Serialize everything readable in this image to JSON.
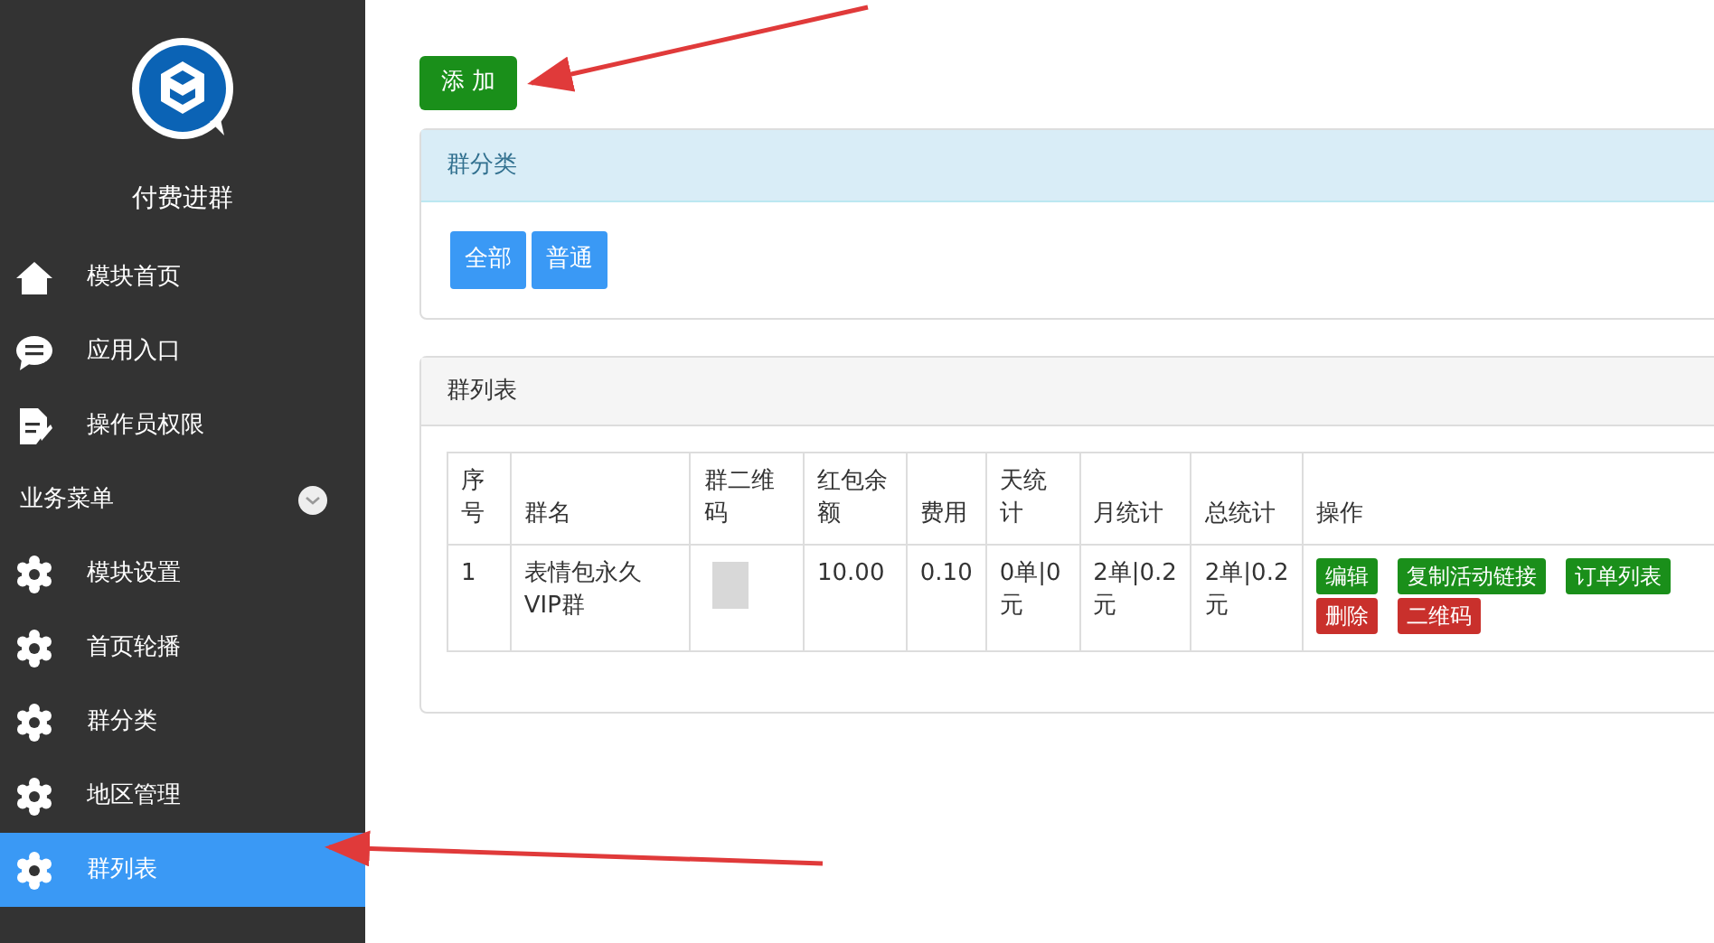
{
  "sidebar": {
    "title": "付费进群",
    "items": [
      {
        "kind": "home",
        "label": "模块首页",
        "selected": false
      },
      {
        "kind": "chat",
        "label": "应用入口",
        "selected": false
      },
      {
        "kind": "doc",
        "label": "操作员权限",
        "selected": false
      },
      {
        "kind": "section",
        "label": "业务菜单",
        "expanded": true
      },
      {
        "kind": "gear",
        "label": "模块设置",
        "selected": false
      },
      {
        "kind": "gear",
        "label": "首页轮播",
        "selected": false
      },
      {
        "kind": "gear",
        "label": "群分类",
        "selected": false
      },
      {
        "kind": "gear",
        "label": "地区管理",
        "selected": false
      },
      {
        "kind": "gear",
        "label": "群列表",
        "selected": true
      }
    ]
  },
  "add_button": "添 加",
  "category_panel": {
    "title": "群分类",
    "buttons": [
      "全部",
      "普通"
    ]
  },
  "list_panel": {
    "title": "群列表",
    "table": {
      "columns": [
        "序号",
        "群名",
        "群二维码",
        "红包余额",
        "费用",
        "天统计",
        "月统计",
        "总统计",
        "操作"
      ],
      "rows": [
        {
          "cells": [
            "1",
            "表情包永久VIP群",
            null,
            "10.00",
            "0.10",
            "0单|0元",
            "2单|0.2元",
            "2单|0.2元"
          ],
          "actions": [
            {
              "label": "编辑",
              "color": "#1a8f1a"
            },
            {
              "label": "复制活动链接",
              "color": "#1a8f1a"
            },
            {
              "label": "订单列表",
              "color": "#1a8f1a"
            },
            {
              "label": "删除",
              "color": "#c9302c"
            },
            {
              "label": "二维码",
              "color": "#c9302c"
            }
          ]
        }
      ]
    }
  }
}
